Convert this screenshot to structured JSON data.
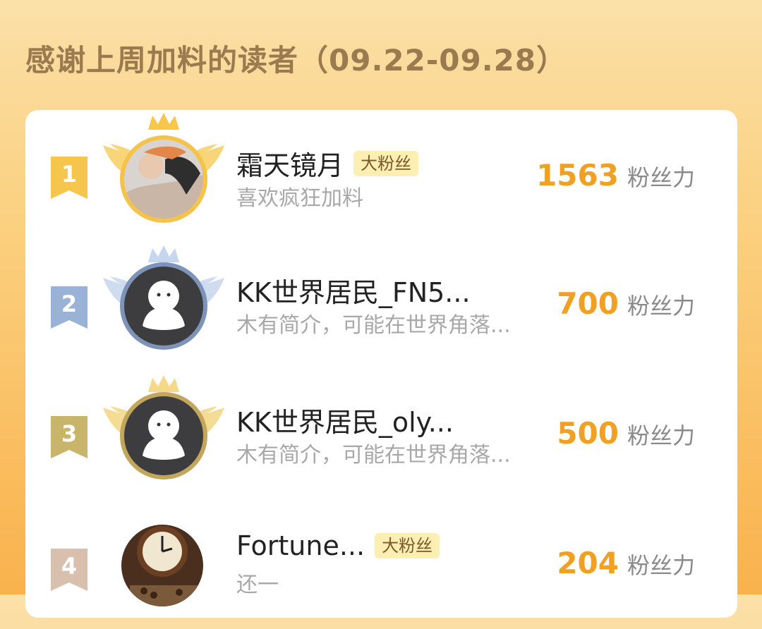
{
  "header": {
    "title": "感谢上周加料的读者（09.22-09.28）"
  },
  "colors": {
    "accent": "#f0a023",
    "gold_ring": "#f5c24a",
    "silver_ring": "#7d93b8",
    "bronze_ring": "#c2a65c",
    "badge_bg": "#fdeeb1"
  },
  "ranking": [
    {
      "rank": "1",
      "name": "霜天镜月",
      "badge": "大粉丝",
      "bio": "喜欢疯狂加料",
      "score": "1563",
      "unit": "粉丝力",
      "avatar": "photo-avatar",
      "frame": "gold-crown-wings"
    },
    {
      "rank": "2",
      "name": "KK世界居民_FN5...",
      "badge": "",
      "bio": "木有简介，可能在世界角落...",
      "score": "700",
      "unit": "粉丝力",
      "avatar": "default-avatar",
      "frame": "silver-crown-wings"
    },
    {
      "rank": "3",
      "name": "KK世界居民_oly...",
      "badge": "",
      "bio": "木有简介，可能在世界角落...",
      "score": "500",
      "unit": "粉丝力",
      "avatar": "default-avatar",
      "frame": "bronze-crown-wings"
    },
    {
      "rank": "4",
      "name": "Fortune...",
      "badge": "大粉丝",
      "bio": "还一",
      "score": "204",
      "unit": "粉丝力",
      "avatar": "clock-photo-avatar",
      "frame": "none"
    }
  ]
}
